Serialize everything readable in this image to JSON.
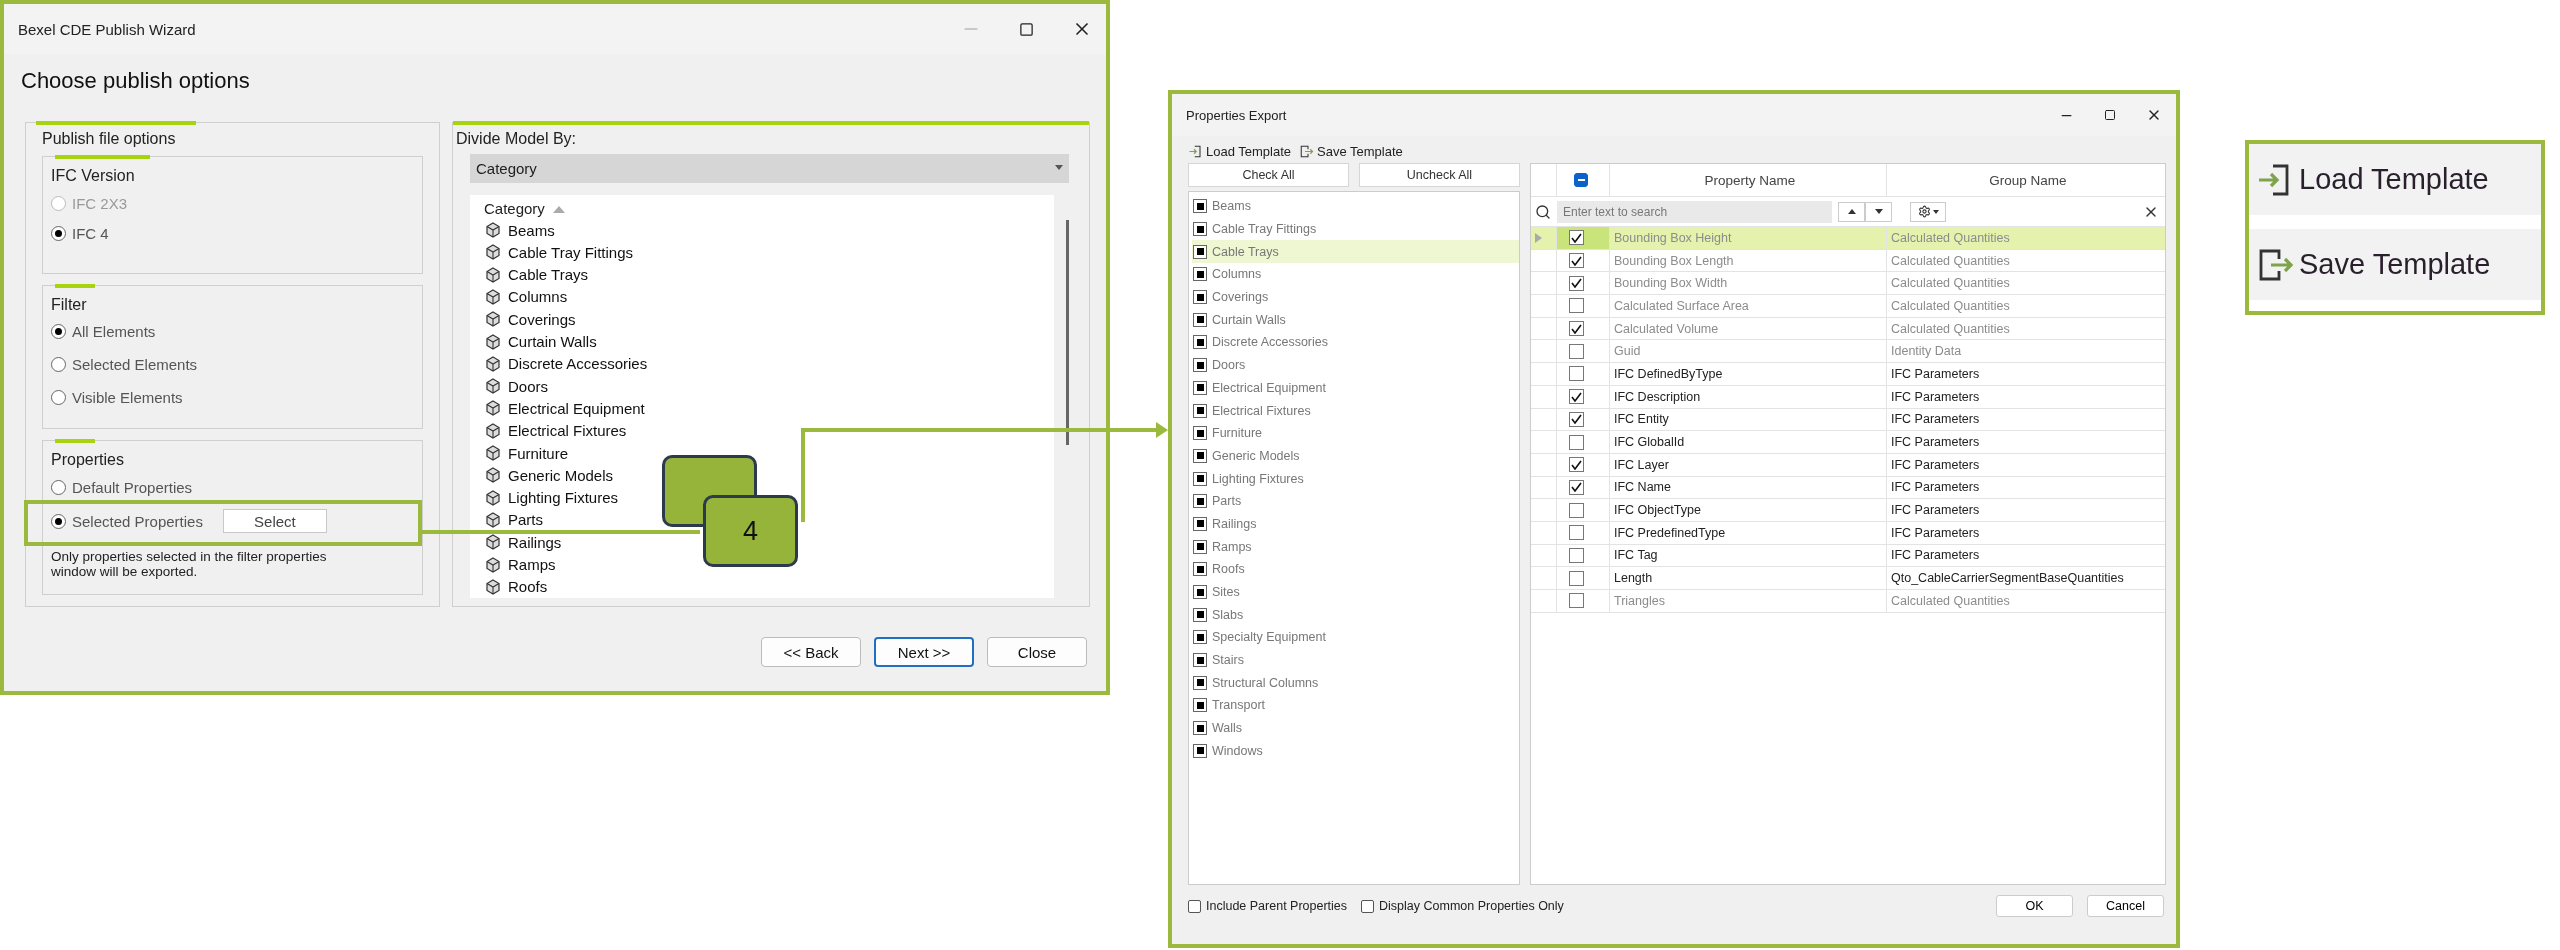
{
  "publish_wizard": {
    "title": "Bexel CDE Publish Wizard",
    "heading": "Choose publish options",
    "publish_file_options": {
      "title": "Publish file options",
      "groups": [
        {
          "title": "IFC Version",
          "options": [
            {
              "label": "IFC 2X3",
              "selected": false,
              "disabled": true
            },
            {
              "label": "IFC 4",
              "selected": true,
              "disabled": false
            }
          ]
        },
        {
          "title": "Filter",
          "options": [
            {
              "label": "All Elements",
              "selected": true,
              "disabled": false
            },
            {
              "label": "Selected Elements",
              "selected": false,
              "disabled": false
            },
            {
              "label": "Visible Elements",
              "selected": false,
              "disabled": false
            }
          ]
        },
        {
          "title": "Properties",
          "options": [
            {
              "label": "Default Properties",
              "selected": false,
              "disabled": false
            },
            {
              "label": "Selected Properties",
              "selected": true,
              "disabled": false,
              "button": "Select"
            }
          ],
          "note": "Only properties selected in the filter properties window will be exported."
        }
      ]
    },
    "divide_model_by": {
      "label": "Divide Model By:",
      "dropdown": "Category",
      "list_header": "Category",
      "items": [
        "Beams",
        "Cable Tray Fittings",
        "Cable Trays",
        "Columns",
        "Coverings",
        "Curtain Walls",
        "Discrete Accessories",
        "Doors",
        "Electrical Equipment",
        "Electrical Fixtures",
        "Furniture",
        "Generic Models",
        "Lighting Fixtures",
        "Parts",
        "Railings",
        "Ramps",
        "Roofs"
      ]
    },
    "buttons": [
      {
        "label": "<< Back",
        "default": false
      },
      {
        "label": "Next >>",
        "default": true
      },
      {
        "label": "Close",
        "default": false
      }
    ]
  },
  "callout": {
    "label": "4"
  },
  "properties_export": {
    "title": "Properties Export",
    "toolbar": [
      {
        "label": "Load Template",
        "kind": "load"
      },
      {
        "label": "Save Template",
        "kind": "save"
      }
    ],
    "check_buttons": [
      "Check All",
      "Uncheck All"
    ],
    "categories": [
      {
        "label": "Beams",
        "indeterminate": true,
        "selected": false
      },
      {
        "label": "Cable Tray Fittings",
        "indeterminate": true,
        "selected": false
      },
      {
        "label": "Cable Trays",
        "indeterminate": true,
        "selected": true
      },
      {
        "label": "Columns",
        "indeterminate": true,
        "selected": false
      },
      {
        "label": "Coverings",
        "indeterminate": true,
        "selected": false
      },
      {
        "label": "Curtain Walls",
        "indeterminate": true,
        "selected": false
      },
      {
        "label": "Discrete Accessories",
        "indeterminate": true,
        "selected": false
      },
      {
        "label": "Doors",
        "indeterminate": true,
        "selected": false
      },
      {
        "label": "Electrical Equipment",
        "indeterminate": true,
        "selected": false
      },
      {
        "label": "Electrical Fixtures",
        "indeterminate": true,
        "selected": false
      },
      {
        "label": "Furniture",
        "indeterminate": true,
        "selected": false
      },
      {
        "label": "Generic Models",
        "indeterminate": true,
        "selected": false
      },
      {
        "label": "Lighting Fixtures",
        "indeterminate": true,
        "selected": false
      },
      {
        "label": "Parts",
        "indeterminate": true,
        "selected": false
      },
      {
        "label": "Railings",
        "indeterminate": true,
        "selected": false
      },
      {
        "label": "Ramps",
        "indeterminate": true,
        "selected": false
      },
      {
        "label": "Roofs",
        "indeterminate": true,
        "selected": false
      },
      {
        "label": "Sites",
        "indeterminate": true,
        "selected": false
      },
      {
        "label": "Slabs",
        "indeterminate": true,
        "selected": false
      },
      {
        "label": "Specialty Equipment",
        "indeterminate": true,
        "selected": false
      },
      {
        "label": "Stairs",
        "indeterminate": true,
        "selected": false
      },
      {
        "label": "Structural Columns",
        "indeterminate": true,
        "selected": false
      },
      {
        "label": "Transport",
        "indeterminate": true,
        "selected": false
      },
      {
        "label": "Walls",
        "indeterminate": true,
        "selected": false
      },
      {
        "label": "Windows",
        "indeterminate": true,
        "selected": false
      }
    ],
    "grid": {
      "header_indeterminate": true,
      "columns": [
        "Property Name",
        "Group Name"
      ],
      "search_placeholder": "Enter text to search",
      "rows": [
        {
          "property": "Bounding Box Height",
          "group": "Calculated Quantities",
          "checked": true,
          "dimmed": true,
          "selected": true
        },
        {
          "property": "Bounding Box Length",
          "group": "Calculated Quantities",
          "checked": true,
          "dimmed": true,
          "selected": false
        },
        {
          "property": "Bounding Box Width",
          "group": "Calculated Quantities",
          "checked": true,
          "dimmed": true,
          "selected": false
        },
        {
          "property": "Calculated Surface Area",
          "group": "Calculated Quantities",
          "checked": false,
          "dimmed": true,
          "selected": false
        },
        {
          "property": "Calculated Volume",
          "group": "Calculated Quantities",
          "checked": true,
          "dimmed": true,
          "selected": false
        },
        {
          "property": "Guid",
          "group": "Identity Data",
          "checked": false,
          "dimmed": true,
          "selected": false
        },
        {
          "property": "IFC DefinedByType",
          "group": "IFC Parameters",
          "checked": false,
          "dimmed": false,
          "selected": false
        },
        {
          "property": "IFC Description",
          "group": "IFC Parameters",
          "checked": true,
          "dimmed": false,
          "selected": false
        },
        {
          "property": "IFC Entity",
          "group": "IFC Parameters",
          "checked": true,
          "dimmed": false,
          "selected": false
        },
        {
          "property": "IFC GlobalId",
          "group": "IFC Parameters",
          "checked": false,
          "dimmed": false,
          "selected": false
        },
        {
          "property": "IFC Layer",
          "group": "IFC Parameters",
          "checked": true,
          "dimmed": false,
          "selected": false
        },
        {
          "property": "IFC Name",
          "group": "IFC Parameters",
          "checked": true,
          "dimmed": false,
          "selected": false
        },
        {
          "property": "IFC ObjectType",
          "group": "IFC Parameters",
          "checked": false,
          "dimmed": false,
          "selected": false
        },
        {
          "property": "IFC PredefinedType",
          "group": "IFC Parameters",
          "checked": false,
          "dimmed": false,
          "selected": false
        },
        {
          "property": "IFC Tag",
          "group": "IFC Parameters",
          "checked": false,
          "dimmed": false,
          "selected": false
        },
        {
          "property": "Length",
          "group": "Qto_CableCarrierSegmentBaseQuantities",
          "checked": false,
          "dimmed": false,
          "selected": false
        },
        {
          "property": "Triangles",
          "group": "Calculated Quantities",
          "checked": false,
          "dimmed": true,
          "selected": false
        }
      ]
    },
    "options": [
      {
        "label": "Include Parent Properties",
        "checked": false
      },
      {
        "label": "Display Common Properties Only",
        "checked": false
      }
    ],
    "buttons": [
      "OK",
      "Cancel"
    ]
  },
  "template_inset": {
    "items": [
      {
        "label": "Load Template",
        "kind": "load"
      },
      {
        "label": "Save Template",
        "kind": "save"
      }
    ]
  }
}
